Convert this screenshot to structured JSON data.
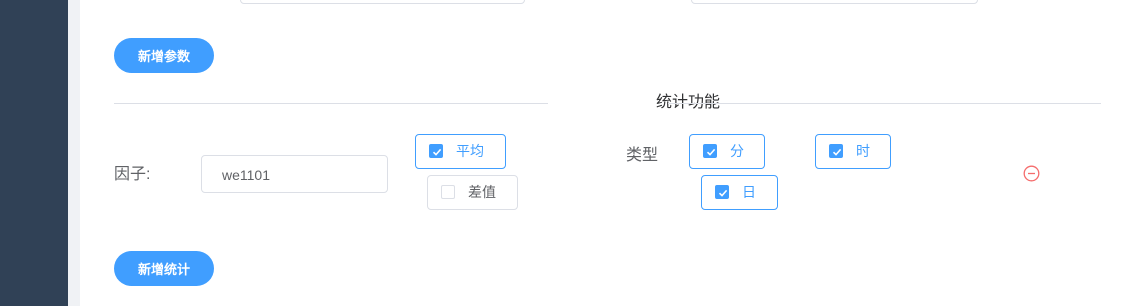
{
  "params": {
    "add_button_label": "新增参数"
  },
  "statistics": {
    "section_title": "统计功能",
    "factor_label": "因子:",
    "factor_value": "we1101",
    "methods": [
      {
        "label": "平均",
        "checked": true
      },
      {
        "label": "差值",
        "checked": false
      }
    ],
    "type_label": "类型",
    "types": [
      {
        "label": "分",
        "checked": true
      },
      {
        "label": "时",
        "checked": true
      },
      {
        "label": "日",
        "checked": true
      }
    ],
    "add_button_label": "新增统计"
  },
  "colors": {
    "primary": "#409eff",
    "danger": "#f56c6c",
    "sidebar": "#304156"
  },
  "icons": {
    "remove": "minus-circle-icon",
    "check": "check-icon"
  }
}
